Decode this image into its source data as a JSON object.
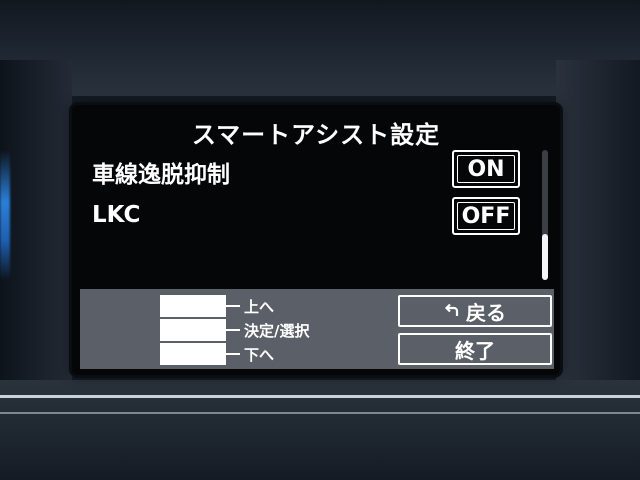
{
  "screen": {
    "title": "スマートアシスト設定",
    "settings": [
      {
        "label": "車線逸脱抑制",
        "value": "ON"
      },
      {
        "label": "LKC",
        "value": "OFF"
      }
    ],
    "scroll": {
      "position": 1.0,
      "visible_fraction": 0.35
    }
  },
  "guide": {
    "keys": [
      {
        "action": "上へ"
      },
      {
        "action": "決定/選択"
      },
      {
        "action": "下へ"
      }
    ],
    "back_button": {
      "label": "戻る",
      "icon": "return-arrow-icon"
    },
    "end_button": {
      "label": "終了"
    }
  },
  "colors": {
    "screen_background": "#050608",
    "panel_background": "#5b6068",
    "text": "#ffffff",
    "dashboard_glow": "#2b7fd8"
  }
}
